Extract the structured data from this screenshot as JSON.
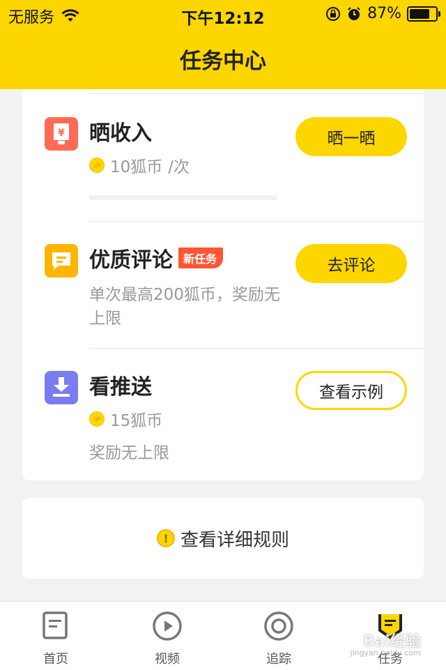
{
  "status_bar": {
    "carrier": "无服务",
    "time": "下午12:12",
    "battery": "87%",
    "battery_level": 0.87
  },
  "header": {
    "title": "任务中心"
  },
  "tasks": [
    {
      "name": "晒收入",
      "reward": "10狐币",
      "reward_unit": "/次",
      "button": "晒一晒",
      "icon": "income-icon",
      "color": "#ff6a55"
    },
    {
      "name": "优质评论",
      "badge": "新任务",
      "desc": "单次最高200狐币，奖励无上限",
      "button": "去评论",
      "icon": "comment-icon",
      "color": "#ffb400"
    },
    {
      "name": "看推送",
      "reward": "15狐币",
      "desc": "奖励无上限",
      "button": "查看示例",
      "icon": "download-icon",
      "color": "#7b7cf0"
    }
  ],
  "rules_link": "查看详细规则",
  "tabbar": [
    {
      "label": "首页"
    },
    {
      "label": "视频"
    },
    {
      "label": "追踪"
    },
    {
      "label": "任务"
    }
  ],
  "watermark": {
    "line1": "Bai经验",
    "line2": "jingyan.baidu.com"
  }
}
